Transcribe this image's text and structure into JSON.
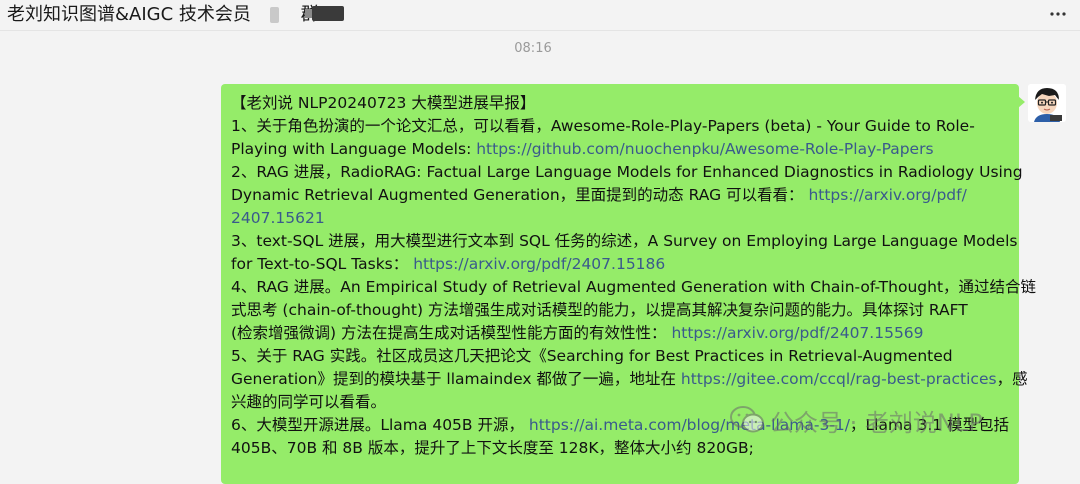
{
  "header": {
    "chat_title": "老刘知识图谱&AIGC 技术会员",
    "group_suffix": "群",
    "menu_icon": "more-dots-icon"
  },
  "timestamp": "08:16",
  "message": {
    "lines": [
      [
        {
          "t": "【老刘说 NLP20240723 大模型进展早报】"
        }
      ],
      [
        {
          "t": "1、关于角色扮演的一个论文汇总，可以看看，Awesome-Role-Play-Papers (beta) - Your Guide to Role-"
        }
      ],
      [
        {
          "t": "Playing with Language Models: "
        },
        {
          "t": "https://github.com/nuochenpku/Awesome-Role-Play-Papers",
          "link": true
        }
      ],
      [
        {
          "t": "2、RAG 进展，RadioRAG: Factual Large Language Models for Enhanced Diagnostics in Radiology Using"
        }
      ],
      [
        {
          "t": "Dynamic Retrieval Augmented Generation，里面提到的动态 RAG 可以看看： "
        },
        {
          "t": "https://arxiv.org/pdf/",
          "link": true
        }
      ],
      [
        {
          "t": "2407.15621",
          "link": true
        }
      ],
      [
        {
          "t": "3、text-SQL 进展，用大模型进行文本到 SQL 任务的综述，A Survey on Employing Large Language Models"
        }
      ],
      [
        {
          "t": "for Text-to-SQL Tasks： "
        },
        {
          "t": "https://arxiv.org/pdf/2407.15186",
          "link": true
        }
      ],
      [
        {
          "t": "4、RAG 进展。An Empirical Study of Retrieval Augmented Generation with Chain-of-Thought，通过结合链"
        }
      ],
      [
        {
          "t": "式思考 (chain-of-thought) 方法增强生成对话模型的能力，以提高其解决复杂问题的能力。具体探讨 RAFT"
        }
      ],
      [
        {
          "t": "(检索增强微调) 方法在提高生成对话模型性能方面的有效性性： "
        },
        {
          "t": "https://arxiv.org/pdf/2407.15569",
          "link": true
        }
      ],
      [
        {
          "t": "5、关于 RAG 实践。社区成员这几天把论文《Searching for Best Practices in Retrieval-Augmented"
        }
      ],
      [
        {
          "t": "Generation》提到的模块基于 llamaindex 都做了一遍，地址在 "
        },
        {
          "t": "https://gitee.com/ccql/rag-best-practices",
          "link": true
        },
        {
          "t": "，感"
        }
      ],
      [
        {
          "t": "兴趣的同学可以看看。"
        }
      ],
      [
        {
          "t": "6、大模型开源进展。Llama 405B 开源， "
        },
        {
          "t": "https://ai.meta.com/blog/meta-llama-3-1/",
          "link": true
        },
        {
          "t": "，Llama 3.1 模型包括"
        }
      ],
      [
        {
          "t": "405B、70B 和 8B 版本，提升了上下文长度至 128K，整体大小约 820GB;"
        }
      ]
    ]
  },
  "watermark": {
    "text": "公众号 · 老刘说NLP",
    "icon": "wechat-official-account-icon"
  },
  "avatar": {
    "icon": "cartoon-avatar-icon"
  },
  "colors": {
    "bubble": "#95ec69",
    "link": "#3a5a8c",
    "background": "#f3f3f3"
  }
}
